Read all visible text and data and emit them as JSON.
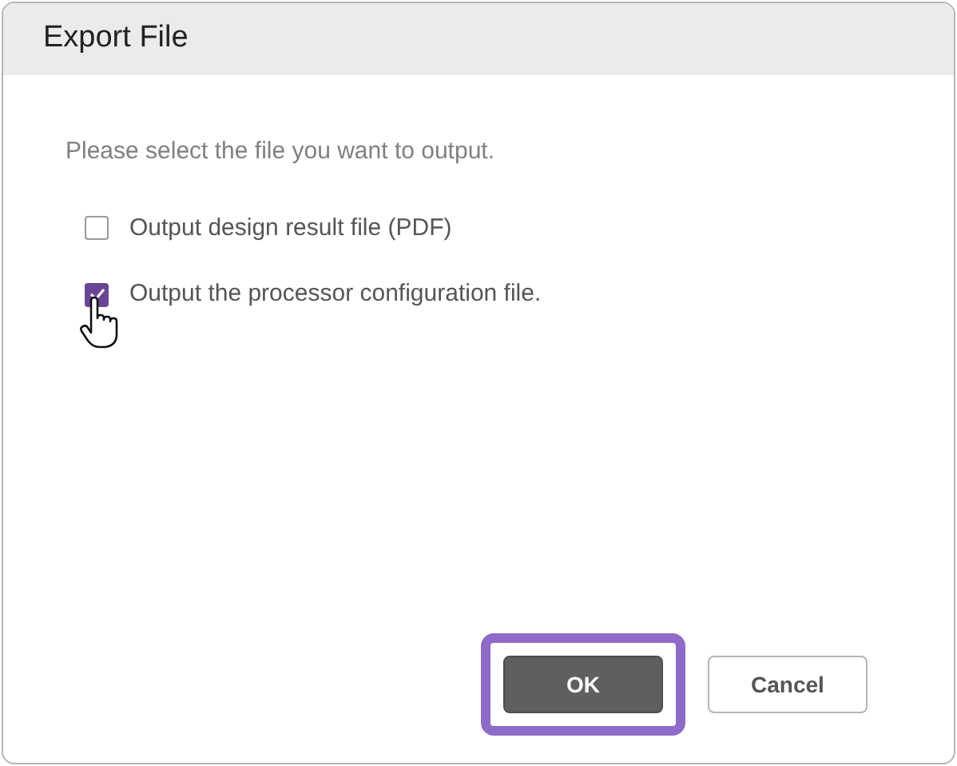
{
  "dialog": {
    "title": "Export File"
  },
  "instruction": "Please select the file you want to output.",
  "options": [
    {
      "label": "Output design result file (PDF)",
      "checked": false,
      "pointer": false
    },
    {
      "label": "Output the processor configuration file.",
      "checked": true,
      "pointer": true
    }
  ],
  "buttons": [
    {
      "label": "OK",
      "kind": "primary",
      "highlighted": true
    },
    {
      "label": "Cancel",
      "kind": "secondary",
      "highlighted": false
    }
  ]
}
